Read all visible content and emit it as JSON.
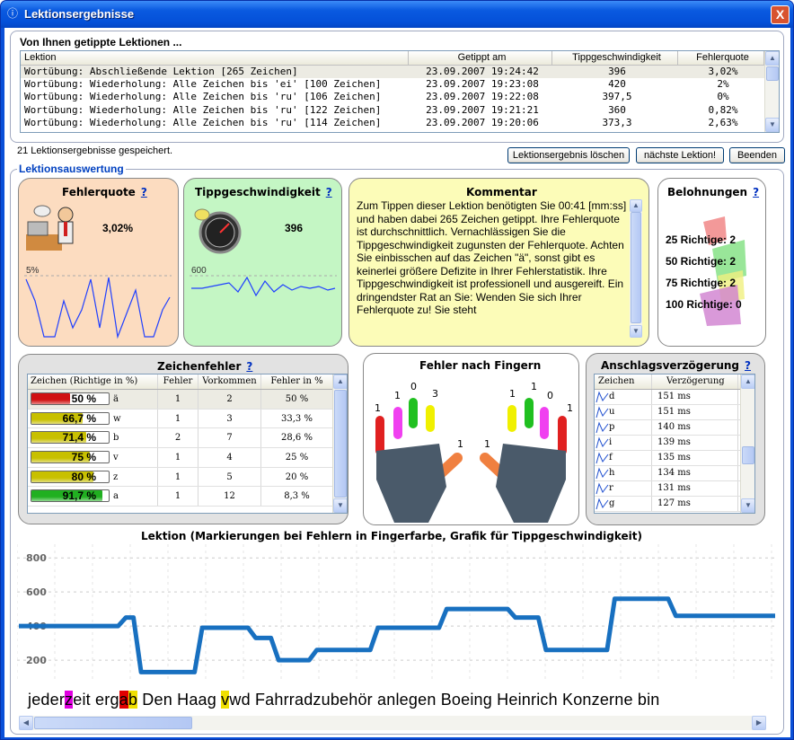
{
  "window": {
    "title": "Lektionsergebnisse",
    "close": "X",
    "icon": "info-icon"
  },
  "lessons": {
    "group_title": "Von Ihnen getippte Lektionen ...",
    "columns": [
      "Lektion",
      "Getippt am",
      "Tippgeschwindigkeit",
      "Fehlerquote"
    ],
    "rows": [
      [
        "Wortübung: Abschließende Lektion [265 Zeichen]",
        "23.09.2007 19:24:42",
        "396",
        "3,02%"
      ],
      [
        "Wortübung: Wiederholung: Alle Zeichen bis 'ei' [100 Zeichen]",
        "23.09.2007 19:23:08",
        "420",
        "2%"
      ],
      [
        "Wortübung: Wiederholung: Alle Zeichen bis 'ru' [106 Zeichen]",
        "23.09.2007 19:22:08",
        "397,5",
        "0%"
      ],
      [
        "Wortübung: Wiederholung: Alle Zeichen bis 'ru' [122 Zeichen]",
        "23.09.2007 19:21:21",
        "360",
        "0,82%"
      ],
      [
        "Wortübung: Wiederholung: Alle Zeichen bis 'ru' [114 Zeichen]",
        "23.09.2007 19:20:06",
        "373,3",
        "2,63%"
      ]
    ],
    "status": "21 Lektionsergebnisse gespeichert."
  },
  "buttons": {
    "delete": "Lektionsergebnis löschen",
    "next": "nächste Lektion!",
    "quit": "Beenden"
  },
  "evaluation": {
    "group_title": "Lektionsauswertung",
    "error_rate": {
      "title": "Fehlerquote",
      "help": "?",
      "value": "3,02%",
      "axis": "5%",
      "icon": "stressed-typist-icon"
    },
    "speed": {
      "title": "Tippgeschwindigkeit",
      "help": "?",
      "value": "396",
      "axis": "600",
      "icon": "speedometer-icon"
    },
    "comment": {
      "title": "Kommentar",
      "text": "Zum Tippen dieser Lektion benötigten Sie 00:41 [mm:ss] und haben dabei 265 Zeichen getippt. Ihre Fehlerquote ist durchschnittlich. Vernachlässigen Sie die Tippgeschwindigkeit zugunsten der Fehlerquote. Achten Sie einbisschen auf das Zeichen \"ä\", sonst gibt es keinerlei größere Defizite in Ihrer Fehlerstatistik. Ihre Tippgeschwindigkeit ist professionell und ausgereift. Ein dringendster Rat an Sie: Wenden Sie sich Ihrer Fehlerquote zu! Sie steht"
    },
    "rewards": {
      "title": "Belohnungen",
      "help": "?",
      "items": [
        "25 Richtige: 2",
        "50 Richtige: 2",
        "75 Richtige: 2",
        "100 Richtige: 0"
      ],
      "icon": "trophy-icon"
    }
  },
  "char_errors": {
    "title": "Zeichenfehler",
    "help": "?",
    "columns": [
      "Zeichen (Richtige in %)",
      "Fehler",
      "Vorkommen",
      "Fehler in %"
    ],
    "rows": [
      {
        "pct": "50 %",
        "ch": "ä",
        "err": "1",
        "occ": "2",
        "errpct": "50 %",
        "ratio": 0.5,
        "color": "#d01010"
      },
      {
        "pct": "66,7 %",
        "ch": "w",
        "err": "1",
        "occ": "3",
        "errpct": "33,3 %",
        "ratio": 0.667,
        "color": "#c8c000"
      },
      {
        "pct": "71,4 %",
        "ch": "b",
        "err": "2",
        "occ": "7",
        "errpct": "28,6 %",
        "ratio": 0.714,
        "color": "#c8c000"
      },
      {
        "pct": "75 %",
        "ch": "v",
        "err": "1",
        "occ": "4",
        "errpct": "25 %",
        "ratio": 0.75,
        "color": "#c8c000"
      },
      {
        "pct": "80 %",
        "ch": "z",
        "err": "1",
        "occ": "5",
        "errpct": "20 %",
        "ratio": 0.8,
        "color": "#c8c000"
      },
      {
        "pct": "91,7 %",
        "ch": "a",
        "err": "1",
        "occ": "12",
        "errpct": "8,3 %",
        "ratio": 0.917,
        "color": "#20b020"
      }
    ]
  },
  "fingers": {
    "title": "Fehler nach Fingern",
    "left": [
      "1",
      "1",
      "0",
      "3",
      "1"
    ],
    "right": [
      "1",
      "0",
      "1",
      "1",
      "1"
    ]
  },
  "delay": {
    "title": "Anschlagsverzögerung",
    "help": "?",
    "columns": [
      "Zeichen",
      "Verzögerung"
    ],
    "rows": [
      [
        "d",
        "151 ms"
      ],
      [
        "u",
        "151 ms"
      ],
      [
        "p",
        "140 ms"
      ],
      [
        "i",
        "139 ms"
      ],
      [
        "f",
        "135 ms"
      ],
      [
        "h",
        "134 ms"
      ],
      [
        "r",
        "131 ms"
      ],
      [
        "g",
        "127 ms"
      ]
    ]
  },
  "lesson_chart": {
    "title": "Lektion (Markierungen bei Fehlern in Fingerfarbe, Grafik für Tippgeschwindigkeit)",
    "words": [
      {
        "t": "jeder"
      },
      {
        "t": "z",
        "m": "#e000e0"
      },
      {
        "t": "eit erg"
      },
      {
        "t": "a",
        "m": "#e00000"
      },
      {
        "t": "b",
        "m": "#f0e000"
      },
      {
        "t": " Den Haag "
      },
      {
        "t": "v",
        "m": "#f0e000"
      },
      {
        "t": "wd Fahrradzubehör anlegen Boeing Heinrich Konzerne bin"
      }
    ]
  },
  "chart_data": {
    "type": "line",
    "title": "Lektion (Markierungen bei Fehlern in Fingerfarbe, Grafik für Tippgeschwindigkeit)",
    "yticks": [
      "800",
      "600",
      "400",
      "200"
    ],
    "ylim": [
      90,
      880
    ],
    "series": [
      {
        "values": [
          400,
          400,
          400,
          400,
          400,
          400,
          400,
          400,
          400,
          400,
          400,
          400,
          400,
          400,
          450,
          450,
          130,
          130,
          130,
          130,
          130,
          130,
          130,
          130,
          390,
          390,
          390,
          390,
          390,
          390,
          390,
          330,
          330,
          330,
          200,
          200,
          200,
          200,
          200,
          260,
          260,
          260,
          260,
          260,
          260,
          260,
          260,
          390,
          390,
          390,
          390,
          390,
          390,
          390,
          390,
          390,
          500,
          500,
          500,
          500,
          500,
          500,
          500,
          500,
          500,
          450,
          450,
          450,
          450,
          260,
          260,
          260,
          260,
          260,
          260,
          260,
          260,
          260,
          560,
          560,
          560,
          560,
          560,
          560,
          560,
          560,
          460,
          460,
          460,
          460,
          460,
          460,
          460,
          460,
          460,
          460,
          460,
          460,
          460,
          460
        ]
      }
    ]
  }
}
